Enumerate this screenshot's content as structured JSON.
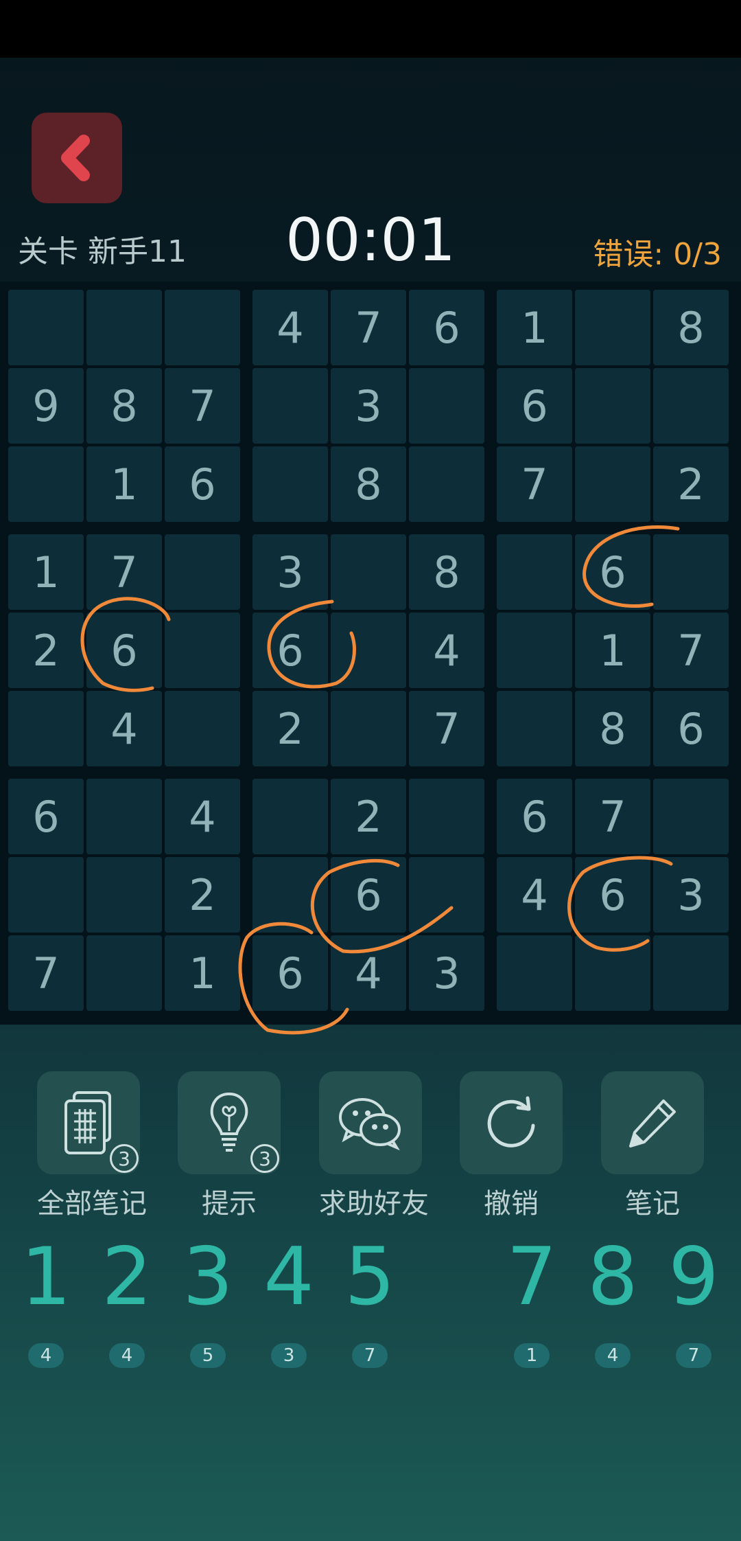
{
  "header": {
    "level_label": "关卡 新手11",
    "timer": "00:01",
    "errors_label": "错误:",
    "errors_value": "0/3"
  },
  "colors": {
    "back_button": "#5c2228",
    "back_icon": "#e0444c",
    "digit": "#2fb7a6",
    "errors": "#f0a43c",
    "annotation": "#f08a3a"
  },
  "board": {
    "grid": [
      [
        "",
        "",
        "",
        "4",
        "7",
        "6",
        "1",
        "",
        "8"
      ],
      [
        "9",
        "8",
        "7",
        "",
        "3",
        "",
        "6",
        "",
        ""
      ],
      [
        "",
        "1",
        "6",
        "",
        "8",
        "",
        "7",
        "",
        "2"
      ],
      [
        "1",
        "7",
        "",
        "3",
        "",
        "8",
        "",
        "6",
        ""
      ],
      [
        "2",
        "6",
        "",
        "6",
        "",
        "4",
        "",
        "1",
        "7"
      ],
      [
        "",
        "4",
        "",
        "2",
        "",
        "7",
        "",
        "8",
        "6"
      ],
      [
        "6",
        "",
        "4",
        "",
        "2",
        "",
        "6",
        "7",
        ""
      ],
      [
        "",
        "",
        "2",
        "",
        "6",
        "",
        "4",
        "6",
        "3"
      ],
      [
        "7",
        "",
        "1",
        "6",
        "4",
        "3",
        "",
        "",
        ""
      ]
    ]
  },
  "tools": [
    {
      "name": "all-notes",
      "label": "全部笔记",
      "icon": "notes-grid-icon",
      "badge": "3"
    },
    {
      "name": "hint",
      "label": "提示",
      "icon": "lightbulb-icon",
      "badge": "3"
    },
    {
      "name": "ask-friend",
      "label": "求助好友",
      "icon": "wechat-icon"
    },
    {
      "name": "undo",
      "label": "撤销",
      "icon": "undo-icon"
    },
    {
      "name": "note",
      "label": "笔记",
      "icon": "pencil-icon"
    }
  ],
  "numpad": [
    {
      "digit": "1",
      "remaining": "4"
    },
    {
      "digit": "2",
      "remaining": "4"
    },
    {
      "digit": "3",
      "remaining": "5"
    },
    {
      "digit": "4",
      "remaining": "3"
    },
    {
      "digit": "5",
      "remaining": "7"
    },
    {
      "digit": "7",
      "remaining": "1"
    },
    {
      "digit": "8",
      "remaining": "4"
    },
    {
      "digit": "9",
      "remaining": "7"
    }
  ]
}
